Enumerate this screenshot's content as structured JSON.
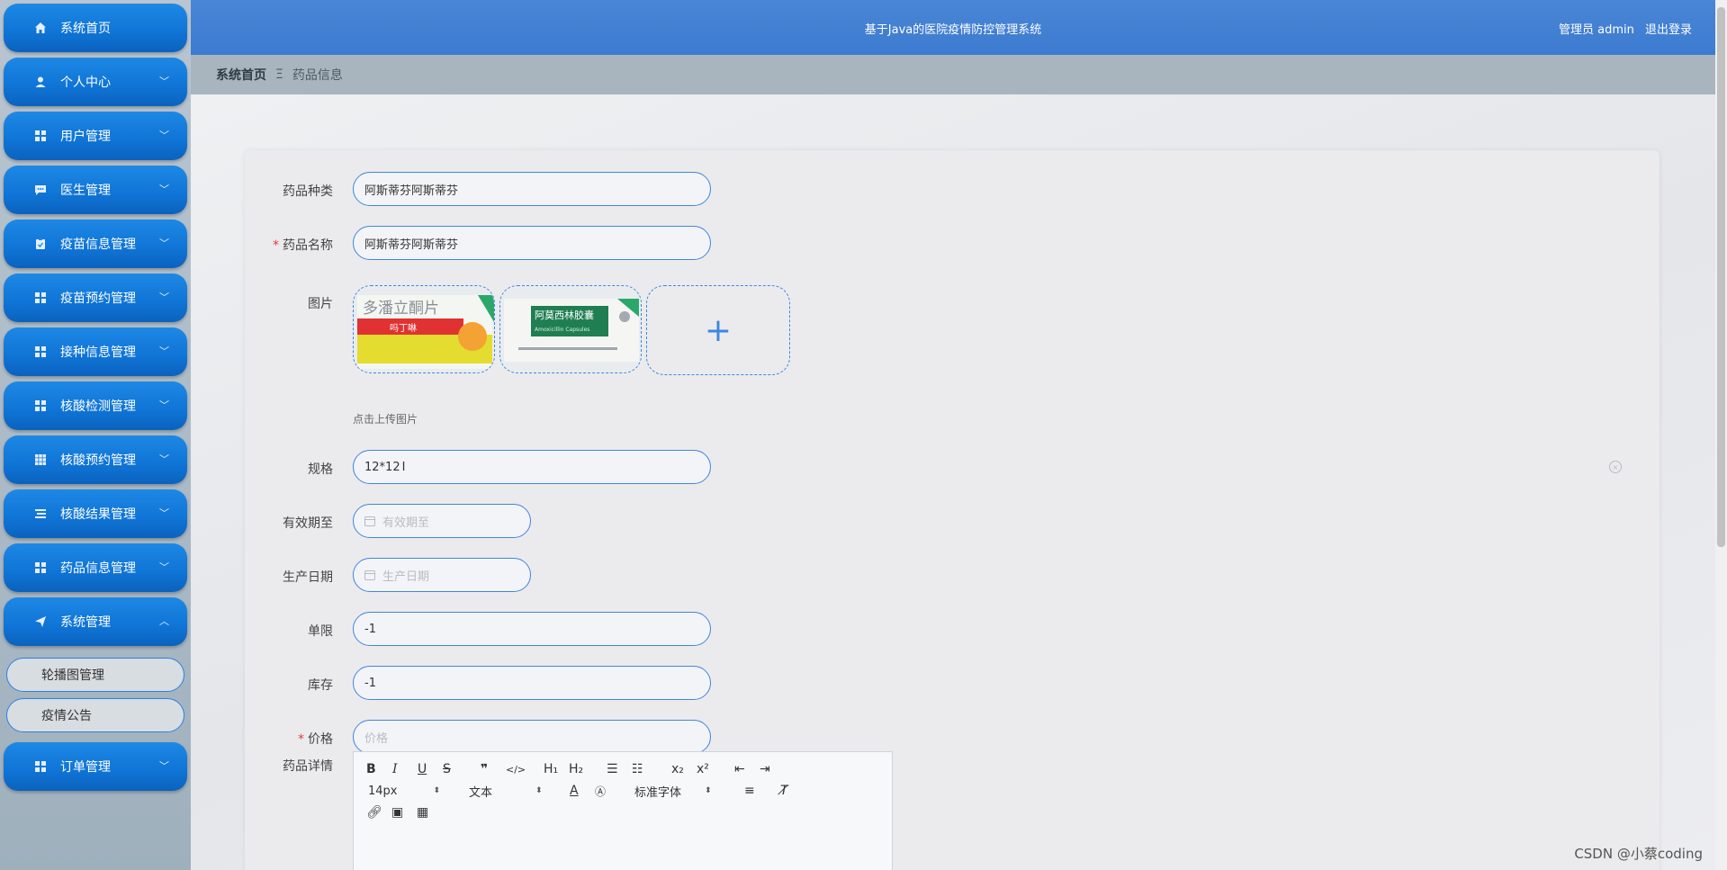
{
  "header": {
    "title": "基于Java的医院疫情防控管理系统",
    "user_label": "管理员 admin",
    "logout_label": "退出登录"
  },
  "breadcrumb": {
    "home": "系统首页",
    "separator": "Ξ",
    "current": "药品信息"
  },
  "sidebar": {
    "items": [
      {
        "label": "系统首页",
        "icon": "home-icon"
      },
      {
        "label": "个人中心",
        "icon": "user-icon"
      },
      {
        "label": "用户管理",
        "icon": "grid-icon"
      },
      {
        "label": "医生管理",
        "icon": "chat-icon"
      },
      {
        "label": "疫苗信息管理",
        "icon": "clipboard-icon"
      },
      {
        "label": "疫苗预约管理",
        "icon": "grid-icon"
      },
      {
        "label": "接种信息管理",
        "icon": "grid-icon"
      },
      {
        "label": "核酸检测管理",
        "icon": "grid-icon"
      },
      {
        "label": "核酸预约管理",
        "icon": "table-icon"
      },
      {
        "label": "核酸结果管理",
        "icon": "list-icon"
      },
      {
        "label": "药品信息管理",
        "icon": "grid-icon"
      },
      {
        "label": "系统管理",
        "icon": "send-icon"
      },
      {
        "label": "订单管理",
        "icon": "grid-icon"
      }
    ],
    "sub_items": [
      {
        "label": "轮播图管理"
      },
      {
        "label": "疫情公告"
      }
    ]
  },
  "form": {
    "category": {
      "label": "药品种类",
      "value": "阿斯蒂芬阿斯蒂芬"
    },
    "name": {
      "label": "药品名称",
      "value": "阿斯蒂芬阿斯蒂芬",
      "required_mark": "*"
    },
    "image": {
      "label": "图片",
      "hint": "点击上传图片",
      "upload_symbol": "+",
      "thumbnails": [
        {
          "title": "多潘立酮片",
          "sub": "吗丁啉"
        },
        {
          "title": "阿莫西林胶囊",
          "sub": "Amoxicillin Capsules"
        }
      ]
    },
    "spec": {
      "label": "规格",
      "value": "12*12"
    },
    "expiry": {
      "label": "有效期至",
      "placeholder": "有效期至"
    },
    "production": {
      "label": "生产日期",
      "placeholder": "生产日期"
    },
    "limit": {
      "label": "单限",
      "value": "-1"
    },
    "stock": {
      "label": "库存",
      "value": "-1"
    },
    "price": {
      "label": "价格",
      "placeholder": "价格",
      "required_mark": "*"
    },
    "detail": {
      "label": "药品详情"
    }
  },
  "editor": {
    "font_size": "14px",
    "text_style": "文本",
    "font_family": "标准字体"
  },
  "watermark": "CSDN @小蔡coding",
  "colors": {
    "accent": "#3f86de",
    "header": "#4a86d6",
    "menu": "#1e88e5",
    "required": "#e4393c"
  }
}
